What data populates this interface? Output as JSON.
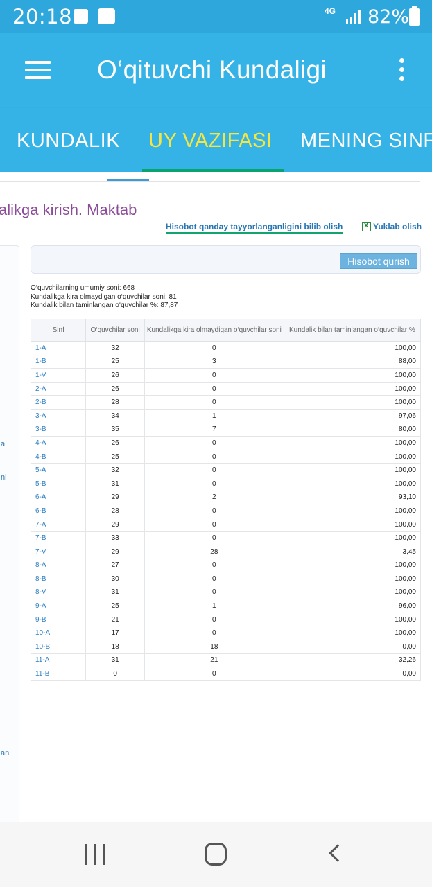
{
  "status_bar": {
    "time": "20:18",
    "network": "4G",
    "battery": "82%",
    "icons": [
      "checkbox-icon",
      "wifi-icon",
      "signal-icon",
      "battery-icon"
    ]
  },
  "app_bar": {
    "title": "O‘qituvchi Kundaligi"
  },
  "tabs": [
    {
      "label": "KUNDALIK",
      "active": false
    },
    {
      "label": "UY VAZIFASI",
      "active": true
    },
    {
      "label": "MENING SINF",
      "active": false
    }
  ],
  "page": {
    "heading": "alikga kirish. Maktab",
    "howto_link": "Hisobot qanday tayyorlanganligini bilib olish",
    "download_link": "Yuklab olish",
    "build_button": "Hisobot qurish",
    "left_fragments": [
      "a",
      "ni",
      "an"
    ]
  },
  "summary": {
    "total": "O‘quvchilarning umumiy soni: 668",
    "not_logged": "Kundalikga kira olmaydigan o‘quvchilar soni: 81",
    "percent": "Kundalik bilan taminlangan o‘quvchilar %: 87,87"
  },
  "table": {
    "headers": [
      "Sinf",
      "O‘quvchilar soni",
      "Kundalikga kira olmaydigan o‘quvchilar soni",
      "Kundalik bilan taminlangan o‘quvchilar %"
    ],
    "rows": [
      [
        "1-A",
        "32",
        "0",
        "100,00"
      ],
      [
        "1-B",
        "25",
        "3",
        "88,00"
      ],
      [
        "1-V",
        "26",
        "0",
        "100,00"
      ],
      [
        "2-A",
        "26",
        "0",
        "100,00"
      ],
      [
        "2-B",
        "28",
        "0",
        "100,00"
      ],
      [
        "3-A",
        "34",
        "1",
        "97,06"
      ],
      [
        "3-B",
        "35",
        "7",
        "80,00"
      ],
      [
        "4-A",
        "26",
        "0",
        "100,00"
      ],
      [
        "4-B",
        "25",
        "0",
        "100,00"
      ],
      [
        "5-A",
        "32",
        "0",
        "100,00"
      ],
      [
        "5-B",
        "31",
        "0",
        "100,00"
      ],
      [
        "6-A",
        "29",
        "2",
        "93,10"
      ],
      [
        "6-B",
        "28",
        "0",
        "100,00"
      ],
      [
        "7-A",
        "29",
        "0",
        "100,00"
      ],
      [
        "7-B",
        "33",
        "0",
        "100,00"
      ],
      [
        "7-V",
        "29",
        "28",
        "3,45"
      ],
      [
        "8-A",
        "27",
        "0",
        "100,00"
      ],
      [
        "8-B",
        "30",
        "0",
        "100,00"
      ],
      [
        "8-V",
        "31",
        "0",
        "100,00"
      ],
      [
        "9-A",
        "25",
        "1",
        "96,00"
      ],
      [
        "9-B",
        "21",
        "0",
        "100,00"
      ],
      [
        "10-A",
        "17",
        "0",
        "100,00"
      ],
      [
        "10-B",
        "18",
        "18",
        "0,00"
      ],
      [
        "11-A",
        "31",
        "21",
        "32,26"
      ],
      [
        "11-B",
        "0",
        "0",
        "0,00"
      ]
    ]
  },
  "nav_bar": {
    "icons": [
      "recents-icon",
      "home-icon",
      "back-icon"
    ]
  }
}
